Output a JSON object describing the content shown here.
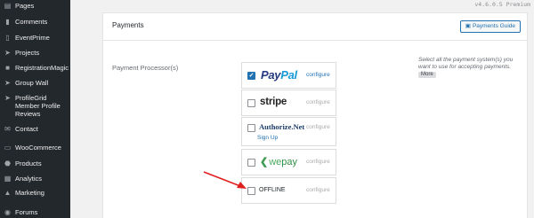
{
  "sidebar": {
    "items": [
      {
        "label": "Pages",
        "icon": "pages-icon"
      },
      {
        "label": "Comments",
        "icon": "comments-icon"
      },
      {
        "label": "EventPrime",
        "icon": "eventprime-icon"
      },
      {
        "label": "Projects",
        "icon": "projects-icon"
      },
      {
        "label": "RegistrationMagic",
        "icon": "registrationmagic-icon"
      },
      {
        "label": "Group Wall",
        "icon": "group-wall-icon"
      },
      {
        "label": "ProfileGrid Member Profile Reviews",
        "icon": "profilegrid-icon"
      },
      {
        "label": "Contact",
        "icon": "contact-icon"
      },
      {
        "label": "WooCommerce",
        "icon": "woocommerce-icon"
      },
      {
        "label": "Products",
        "icon": "products-icon"
      },
      {
        "label": "Analytics",
        "icon": "analytics-icon"
      },
      {
        "label": "Marketing",
        "icon": "marketing-icon"
      },
      {
        "label": "Forums",
        "icon": "forums-icon"
      }
    ]
  },
  "version": "v4.6.0.5 Premium",
  "payments": {
    "title": "Payments",
    "guide_button": "Payments Guide",
    "processor_label": "Payment Processor(s)",
    "help_text": "Select all the payment system(s) you want to use for accepting payments.",
    "help_more": "More",
    "gateways": [
      {
        "name": "PayPal",
        "logo_a": "Pay",
        "logo_b": "Pal",
        "checked": true,
        "configure": "configure"
      },
      {
        "name": "stripe",
        "checked": false,
        "configure": "configure"
      },
      {
        "name": "Authorize.Net",
        "signup": "Sign Up",
        "checked": false,
        "configure": "configure"
      },
      {
        "name": "wepay",
        "logo_a": "we",
        "logo_b": "pay",
        "checked": false,
        "configure": "configure"
      },
      {
        "name": "OFFLINE",
        "checked": false,
        "configure": "configure"
      }
    ]
  },
  "colors": {
    "sidebar_bg": "#23282d",
    "accent": "#2271b1",
    "paypal_dark": "#253b80",
    "paypal_light": "#179bd7",
    "annotation_arrow": "#e02020"
  }
}
